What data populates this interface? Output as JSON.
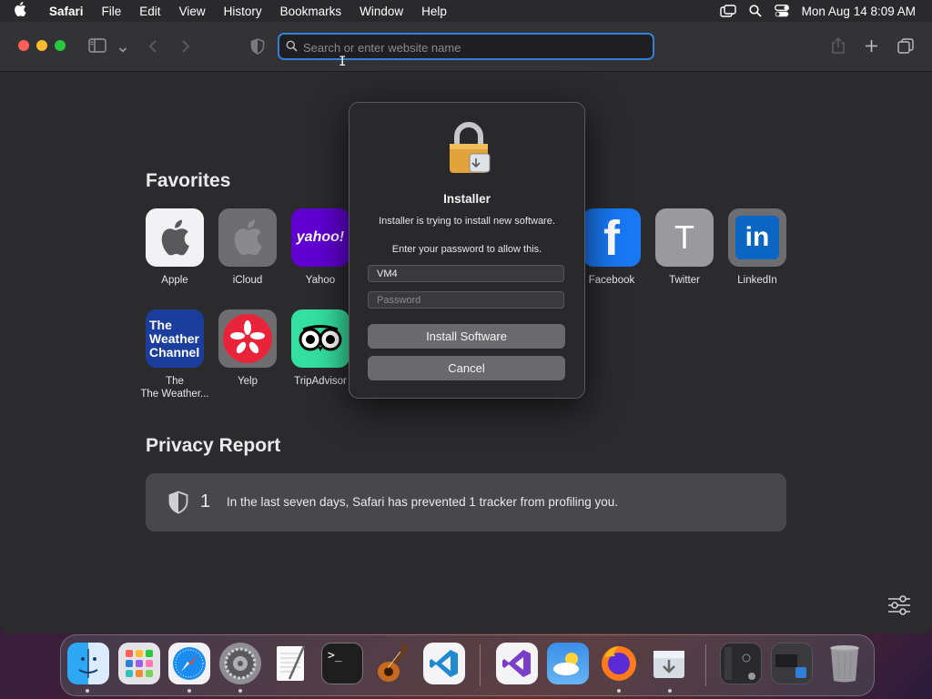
{
  "menubar": {
    "app_name": "Safari",
    "items": [
      "File",
      "Edit",
      "View",
      "History",
      "Bookmarks",
      "Window",
      "Help"
    ],
    "datetime": "Mon Aug 14  8:09 AM"
  },
  "toolbar": {
    "address_placeholder": "Search or enter website name"
  },
  "favorites": {
    "title": "Favorites",
    "items": [
      {
        "label": "Apple"
      },
      {
        "label": "iCloud"
      },
      {
        "label": "Yahoo",
        "tile_text": "yahoo!"
      },
      {
        "label": "Facebook",
        "tile_text": "f"
      },
      {
        "label": "Twitter",
        "tile_text": "T"
      },
      {
        "label": "LinkedIn",
        "tile_text": "in"
      },
      {
        "label": "The Weather...",
        "tile_text": "The Weather Channel"
      },
      {
        "label": "Yelp"
      },
      {
        "label": "TripAdvisor"
      }
    ]
  },
  "privacy": {
    "title": "Privacy Report",
    "count": "1",
    "text": "In the last seven days, Safari has prevented 1 tracker from profiling you."
  },
  "dialog": {
    "title": "Installer",
    "message": "Installer is trying to install new software.",
    "prompt": "Enter your password to allow this.",
    "username_value": "VM4",
    "password_placeholder": "Password",
    "install_label": "Install Software",
    "cancel_label": "Cancel"
  },
  "dock": {
    "apps": [
      "finder-icon",
      "launchpad-icon",
      "safari-icon",
      "system-settings-icon",
      "textedit-icon",
      "terminal-icon",
      "garageband-icon",
      "vscode-icon",
      "visual-studio-icon",
      "weather-icon",
      "firefox-icon",
      "installer-icon",
      "window-thumbnail-icon",
      "window-thumbnail-icon",
      "trash-icon"
    ],
    "terminal_prompt": ">_"
  },
  "colors": {
    "accent": "#2f7fd7",
    "background": "#2b2b2d",
    "dialog_button": "#6a6a6c"
  }
}
